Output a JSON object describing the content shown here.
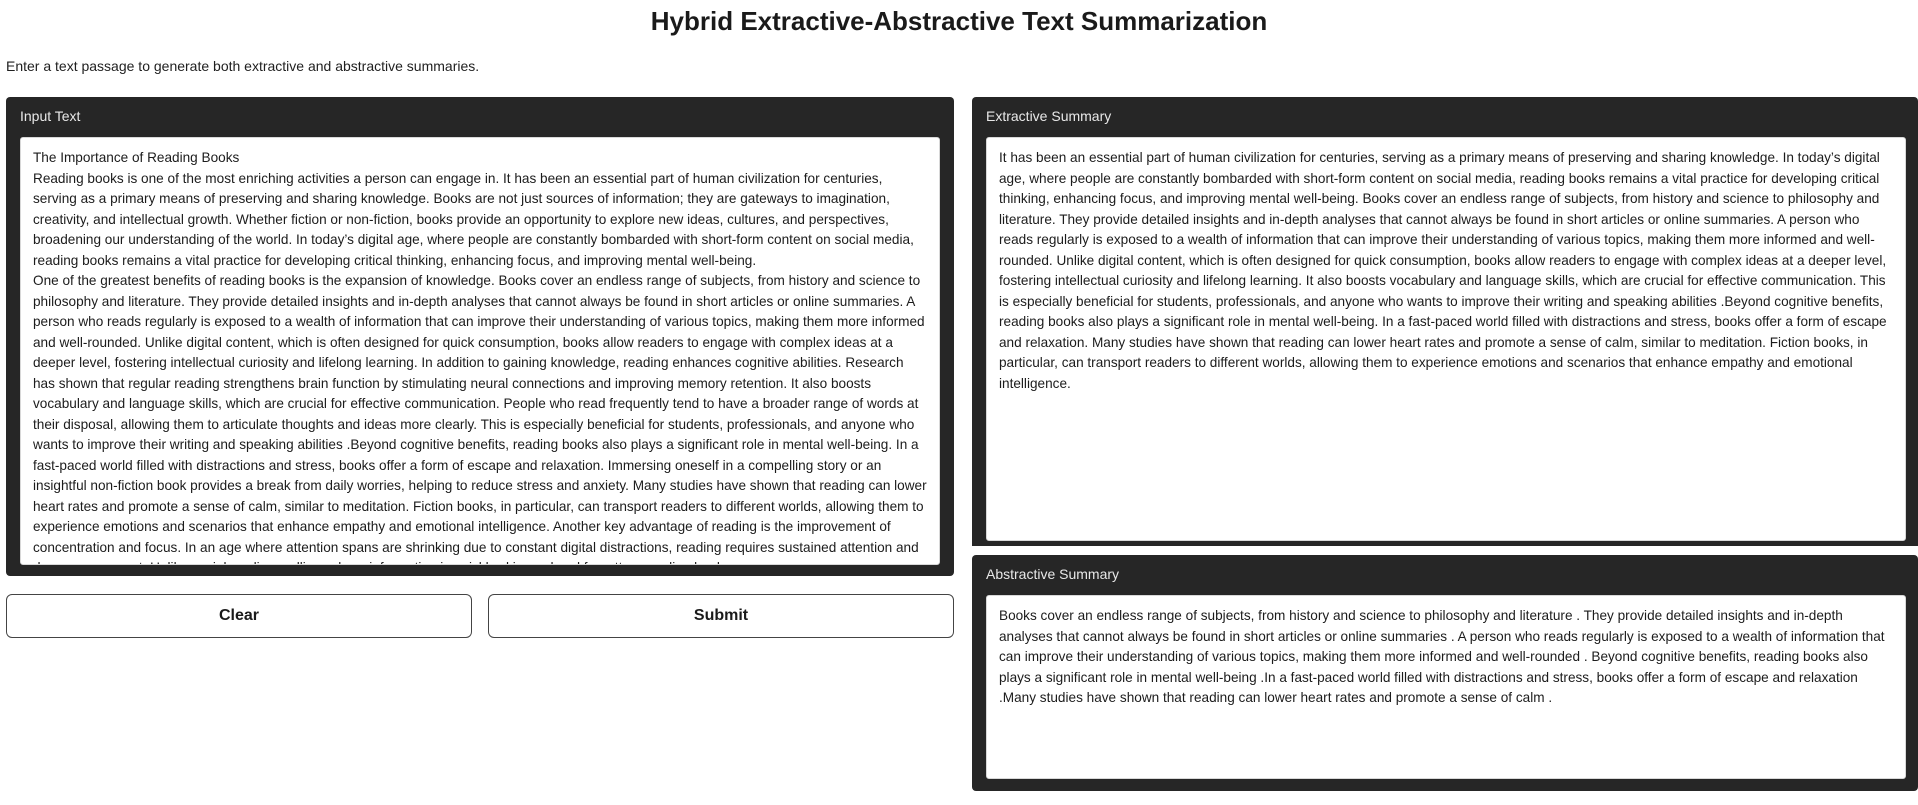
{
  "app": {
    "title": "Hybrid Extractive-Abstractive Text Summarization",
    "description": "Enter a text passage to generate both extractive and abstractive summaries."
  },
  "input": {
    "label": "Input Text",
    "value": "The Importance of Reading Books\nReading books is one of the most enriching activities a person can engage in. It has been an essential part of human civilization for centuries, serving as a primary means of preserving and sharing knowledge. Books are not just sources of information; they are gateways to imagination, creativity, and intellectual growth. Whether fiction or non-fiction, books provide an opportunity to explore new ideas, cultures, and perspectives, broadening our understanding of the world. In today’s digital age, where people are constantly bombarded with short-form content on social media, reading books remains a vital practice for developing critical thinking, enhancing focus, and improving mental well-being.\nOne of the greatest benefits of reading books is the expansion of knowledge. Books cover an endless range of subjects, from history and science to philosophy and literature. They provide detailed insights and in-depth analyses that cannot always be found in short articles or online summaries. A person who reads regularly is exposed to a wealth of information that can improve their understanding of various topics, making them more informed and well-rounded. Unlike digital content, which is often designed for quick consumption, books allow readers to engage with complex ideas at a deeper level, fostering intellectual curiosity and lifelong learning. In addition to gaining knowledge, reading enhances cognitive abilities. Research has shown that regular reading strengthens brain function by stimulating neural connections and improving memory retention. It also boosts vocabulary and language skills, which are crucial for effective communication. People who read frequently tend to have a broader range of words at their disposal, allowing them to articulate thoughts and ideas more clearly. This is especially beneficial for students, professionals, and anyone who wants to improve their writing and speaking abilities .Beyond cognitive benefits, reading books also plays a significant role in mental well-being. In a fast-paced world filled with distractions and stress, books offer a form of escape and relaxation. Immersing oneself in a compelling story or an insightful non-fiction book provides a break from daily worries, helping to reduce stress and anxiety. Many studies have shown that reading can lower heart rates and promote a sense of calm, similar to meditation. Fiction books, in particular, can transport readers to different worlds, allowing them to experience emotions and scenarios that enhance empathy and emotional intelligence. Another key advantage of reading is the improvement of concentration and focus. In an age where attention spans are shrinking due to constant digital distractions, reading requires sustained attention and deep engagement. Unlike social media scrolling, where information is quickly skimmed and forgotten, reading books"
  },
  "buttons": {
    "clear": "Clear",
    "submit": "Submit"
  },
  "extractive": {
    "label": "Extractive Summary",
    "value": "It has been an essential part of human civilization for centuries, serving as a primary means of preserving and sharing knowledge. In today’s digital age, where people are constantly bombarded with short-form content on social media, reading books remains a vital practice for developing critical thinking, enhancing focus, and improving mental well-being. Books cover an endless range of subjects, from history and science to philosophy and literature. They provide detailed insights and in-depth analyses that cannot always be found in short articles or online summaries. A person who reads regularly is exposed to a wealth of information that can improve their understanding of various topics, making them more informed and well-rounded. Unlike digital content, which is often designed for quick consumption, books allow readers to engage with complex ideas at a deeper level, fostering intellectual curiosity and lifelong learning. It also boosts vocabulary and language skills, which are crucial for effective communication. This is especially beneficial for students, professionals, and anyone who wants to improve their writing and speaking abilities .Beyond cognitive benefits, reading books also plays a significant role in mental well-being. In a fast-paced world filled with distractions and stress, books offer a form of escape and relaxation. Many studies have shown that reading can lower heart rates and promote a sense of calm, similar to meditation. Fiction books, in particular, can transport readers to different worlds, allowing them to experience emotions and scenarios that enhance empathy and emotional intelligence."
  },
  "abstractive": {
    "label": "Abstractive Summary",
    "value": "Books cover an endless range of subjects, from history and science to philosophy and literature . They provide detailed insights and in-depth analyses that cannot always be found in short articles or online summaries . A person who reads regularly is exposed to a wealth of information that can improve their understanding of various topics, making them more informed and well-rounded . Beyond cognitive benefits, reading books also plays a significant role in mental well-being .In a fast-paced world filled with distractions and stress, books offer a form of escape and relaxation .Many studies have shown that reading can lower heart rates and promote a sense of calm ."
  }
}
